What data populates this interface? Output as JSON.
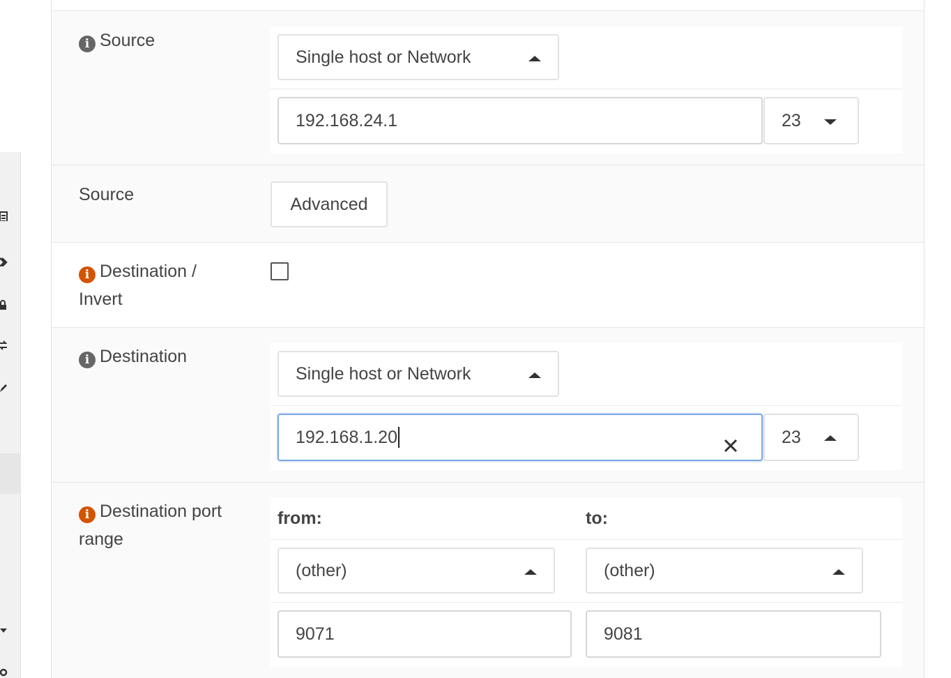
{
  "sidebar": {
    "icons": [
      "list-icon",
      "tag-icon",
      "lock-icon",
      "transfer-icon",
      "pencil-icon",
      "chevron-down-icon",
      "gear-icon"
    ]
  },
  "source": {
    "label": "Source",
    "type_select": "Single host or Network",
    "address": "192.168.24.1",
    "mask": "23"
  },
  "source_advanced": {
    "label": "Source",
    "button": "Advanced"
  },
  "destination_invert": {
    "label_line1": "Destination /",
    "label_line2": "Invert",
    "checked": false
  },
  "destination": {
    "label": "Destination",
    "type_select": "Single host or Network",
    "address": "192.168.1.20",
    "mask": "23"
  },
  "port_range": {
    "label_line1": "Destination port",
    "label_line2": "range",
    "from_label": "from:",
    "to_label": "to:",
    "from_select": "(other)",
    "to_select": "(other)",
    "from_value": "9071",
    "to_value": "9081"
  },
  "colors": {
    "info_grey": "#666666",
    "info_orange": "#d35400",
    "focus_border": "#7aa7e6"
  }
}
